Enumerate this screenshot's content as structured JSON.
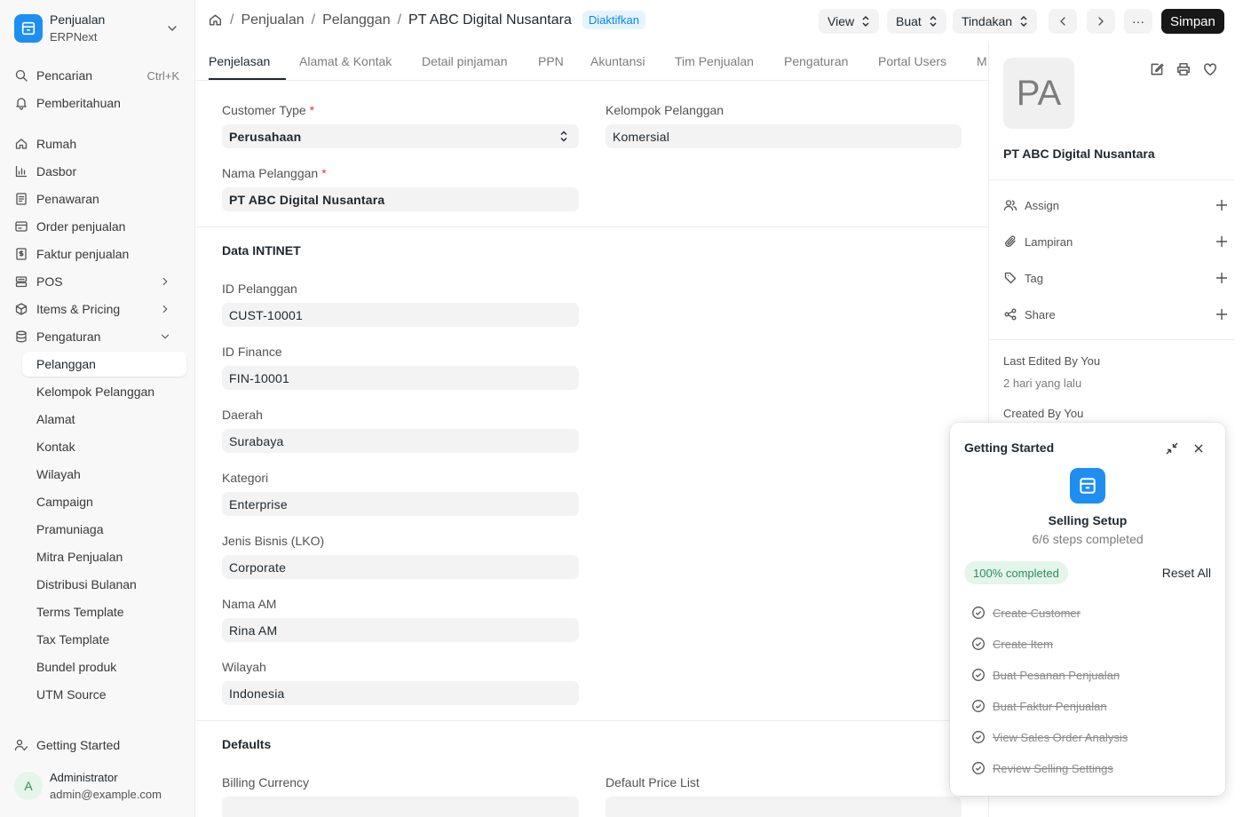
{
  "app": {
    "name": "Penjualan",
    "subtitle": "ERPNext"
  },
  "sidebar": {
    "search": {
      "label": "Pencarian",
      "shortcut": "Ctrl+K"
    },
    "notifications": {
      "label": "Pemberitahuan"
    },
    "items": [
      {
        "label": "Rumah",
        "icon": "home-icon"
      },
      {
        "label": "Dasbor",
        "icon": "chart-icon"
      },
      {
        "label": "Penawaran",
        "icon": "quotation-icon"
      },
      {
        "label": "Order penjualan",
        "icon": "order-icon"
      },
      {
        "label": "Faktur penjualan",
        "icon": "invoice-icon"
      },
      {
        "label": "POS",
        "icon": "pos-icon"
      },
      {
        "label": "Items & Pricing",
        "icon": "box-icon"
      },
      {
        "label": "Pengaturan",
        "icon": "database-icon"
      }
    ],
    "children": [
      "Pelanggan",
      "Kelompok Pelanggan",
      "Alamat",
      "Kontak",
      "Wilayah",
      "Campaign",
      "Pramuniaga",
      "Mitra Penjualan",
      "Distribusi Bulanan",
      "Terms Template",
      "Tax Template",
      "Bundel produk",
      "UTM Source"
    ],
    "getting_started": "Getting Started",
    "user": {
      "initial": "A",
      "name": "Administrator",
      "email": "admin@example.com"
    }
  },
  "breadcrumb": {
    "items": [
      "Penjualan",
      "Pelanggan"
    ],
    "current": "PT ABC Digital Nusantara",
    "status": "Diaktifkan"
  },
  "toolbar": {
    "view": "View",
    "create": "Buat",
    "actions": "Tindakan",
    "more": "···",
    "save": "Simpan"
  },
  "tabs": [
    "Penjelasan",
    "Alamat & Kontak",
    "Detail pinjaman",
    "PPN",
    "Akuntansi",
    "Tim Penjualan",
    "Pengaturan",
    "Portal Users",
    "M"
  ],
  "form": {
    "customer_type": {
      "label": "Customer Type",
      "value": "Perusahaan"
    },
    "customer_group": {
      "label": "Kelompok Pelanggan",
      "value": "Komersial"
    },
    "customer_name": {
      "label": "Nama Pelanggan",
      "value": "PT ABC Digital Nusantara"
    },
    "section_intinet": "Data INTINET",
    "fields": [
      {
        "label": "ID Pelanggan",
        "value": "CUST-10001"
      },
      {
        "label": "ID Finance",
        "value": "FIN-10001"
      },
      {
        "label": "Daerah",
        "value": "Surabaya"
      },
      {
        "label": "Kategori",
        "value": "Enterprise"
      },
      {
        "label": "Jenis Bisnis (LKO)",
        "value": "Corporate"
      },
      {
        "label": "Nama AM",
        "value": "Rina AM"
      },
      {
        "label": "Wilayah",
        "value": "Indonesia"
      }
    ],
    "section_defaults": "Defaults",
    "billing_currency": {
      "label": "Billing Currency",
      "value": ""
    },
    "default_price_list": {
      "label": "Default Price List",
      "value": ""
    }
  },
  "side_panel": {
    "avatar_initials": "PA",
    "title": "PT ABC Digital Nusantara",
    "rows": [
      {
        "label": "Assign",
        "icon": "users-icon"
      },
      {
        "label": "Lampiran",
        "icon": "paperclip-icon"
      },
      {
        "label": "Tag",
        "icon": "tag-icon"
      },
      {
        "label": "Share",
        "icon": "share-icon"
      }
    ],
    "last_edited": "Last Edited By You",
    "last_edited_time": "2 hari yang lalu",
    "created": "Created By You"
  },
  "getting_started": {
    "title": "Getting Started",
    "heading": "Selling Setup",
    "progress_text": "6/6 steps completed",
    "progress": 1.0,
    "badge": "100% completed",
    "reset": "Reset All",
    "steps": [
      "Create Customer",
      "Create Item",
      "Buat Pesanan Penjualan",
      "Buat Faktur Penjualan",
      "View Sales Order Analysis",
      "Review Selling Settings"
    ]
  },
  "colors": {
    "accent": "#1e8ff0",
    "success_bg": "#e4f5e9",
    "success_text": "#278f5e",
    "status_bg": "#e6f4ff",
    "status_text": "#0289f7"
  }
}
